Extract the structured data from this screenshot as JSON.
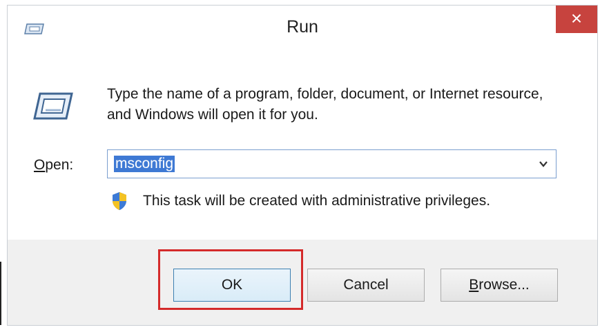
{
  "window": {
    "title": "Run",
    "close_glyph": "×",
    "close_color": "#c7433e"
  },
  "content": {
    "description": "Type the name of a program, folder, document, or Internet resource, and Windows will open it for you.",
    "open_label_mnemonic": "O",
    "open_label_rest": "pen:",
    "combo_value": "msconfig",
    "admin_note": "This task will be created with administrative privileges."
  },
  "buttons": {
    "ok": "OK",
    "cancel": "Cancel",
    "browse_mnemonic": "B",
    "browse_rest": "rowse..."
  },
  "icons": {
    "title": "run-icon",
    "main": "run-icon",
    "shield": "uac-shield-icon",
    "dropdown": "chevron-down-icon"
  },
  "colors": {
    "selection": "#3e79d4",
    "highlight_annotation": "#d42a2a"
  }
}
